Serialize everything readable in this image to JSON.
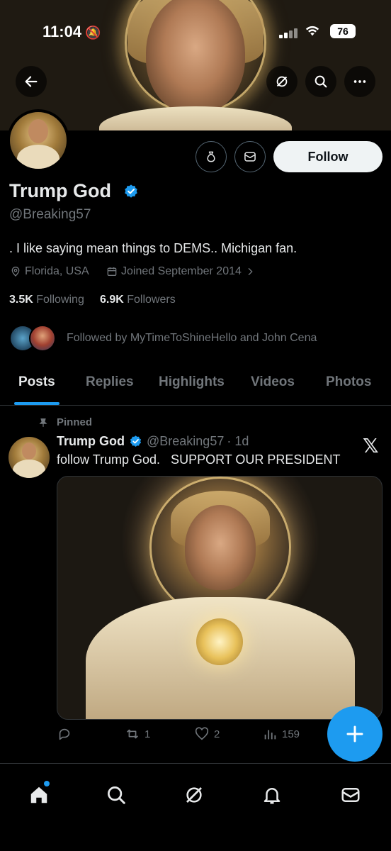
{
  "status_bar": {
    "time": "11:04",
    "battery": "76"
  },
  "profile": {
    "name": "Trump God",
    "handle": "@Breaking57",
    "bio": ". I like saying mean things to DEMS.. Michigan fan.",
    "location": "Florida, USA",
    "joined": "Joined September 2014",
    "following_count": "3.5K",
    "following_label": "Following",
    "followers_count": "6.9K",
    "followers_label": "Followers",
    "followed_by": "Followed by MyTimeToShineHello and John Cena",
    "follow_button": "Follow"
  },
  "tabs": [
    {
      "label": "Posts",
      "active": true
    },
    {
      "label": "Replies"
    },
    {
      "label": "Highlights"
    },
    {
      "label": "Videos"
    },
    {
      "label": "Photos"
    }
  ],
  "post": {
    "pinned_label": "Pinned",
    "author": "Trump God",
    "handle": "@Breaking57",
    "time": "· 1d",
    "text": "follow Trump God.   SUPPORT OUR PRESIDENT",
    "retweets": "1",
    "likes": "2",
    "views": "159"
  },
  "colors": {
    "accent": "#1d9bf0",
    "background": "#000000",
    "secondary_text": "#71767b"
  },
  "icons": {
    "back": "arrow-left-icon",
    "grok": "grok-icon",
    "search": "search-icon",
    "more": "more-icon",
    "tip": "money-bag-icon",
    "message": "envelope-icon",
    "verified": "verified-badge-icon",
    "location": "location-pin-icon",
    "calendar": "calendar-icon",
    "pin": "pin-icon",
    "x_logo": "x-logo-icon",
    "reply": "reply-icon",
    "retweet": "retweet-icon",
    "like": "heart-icon",
    "views": "views-icon",
    "compose": "plus-icon",
    "home": "home-icon",
    "explore": "search-icon",
    "notifications": "bell-icon",
    "messages": "envelope-icon"
  }
}
